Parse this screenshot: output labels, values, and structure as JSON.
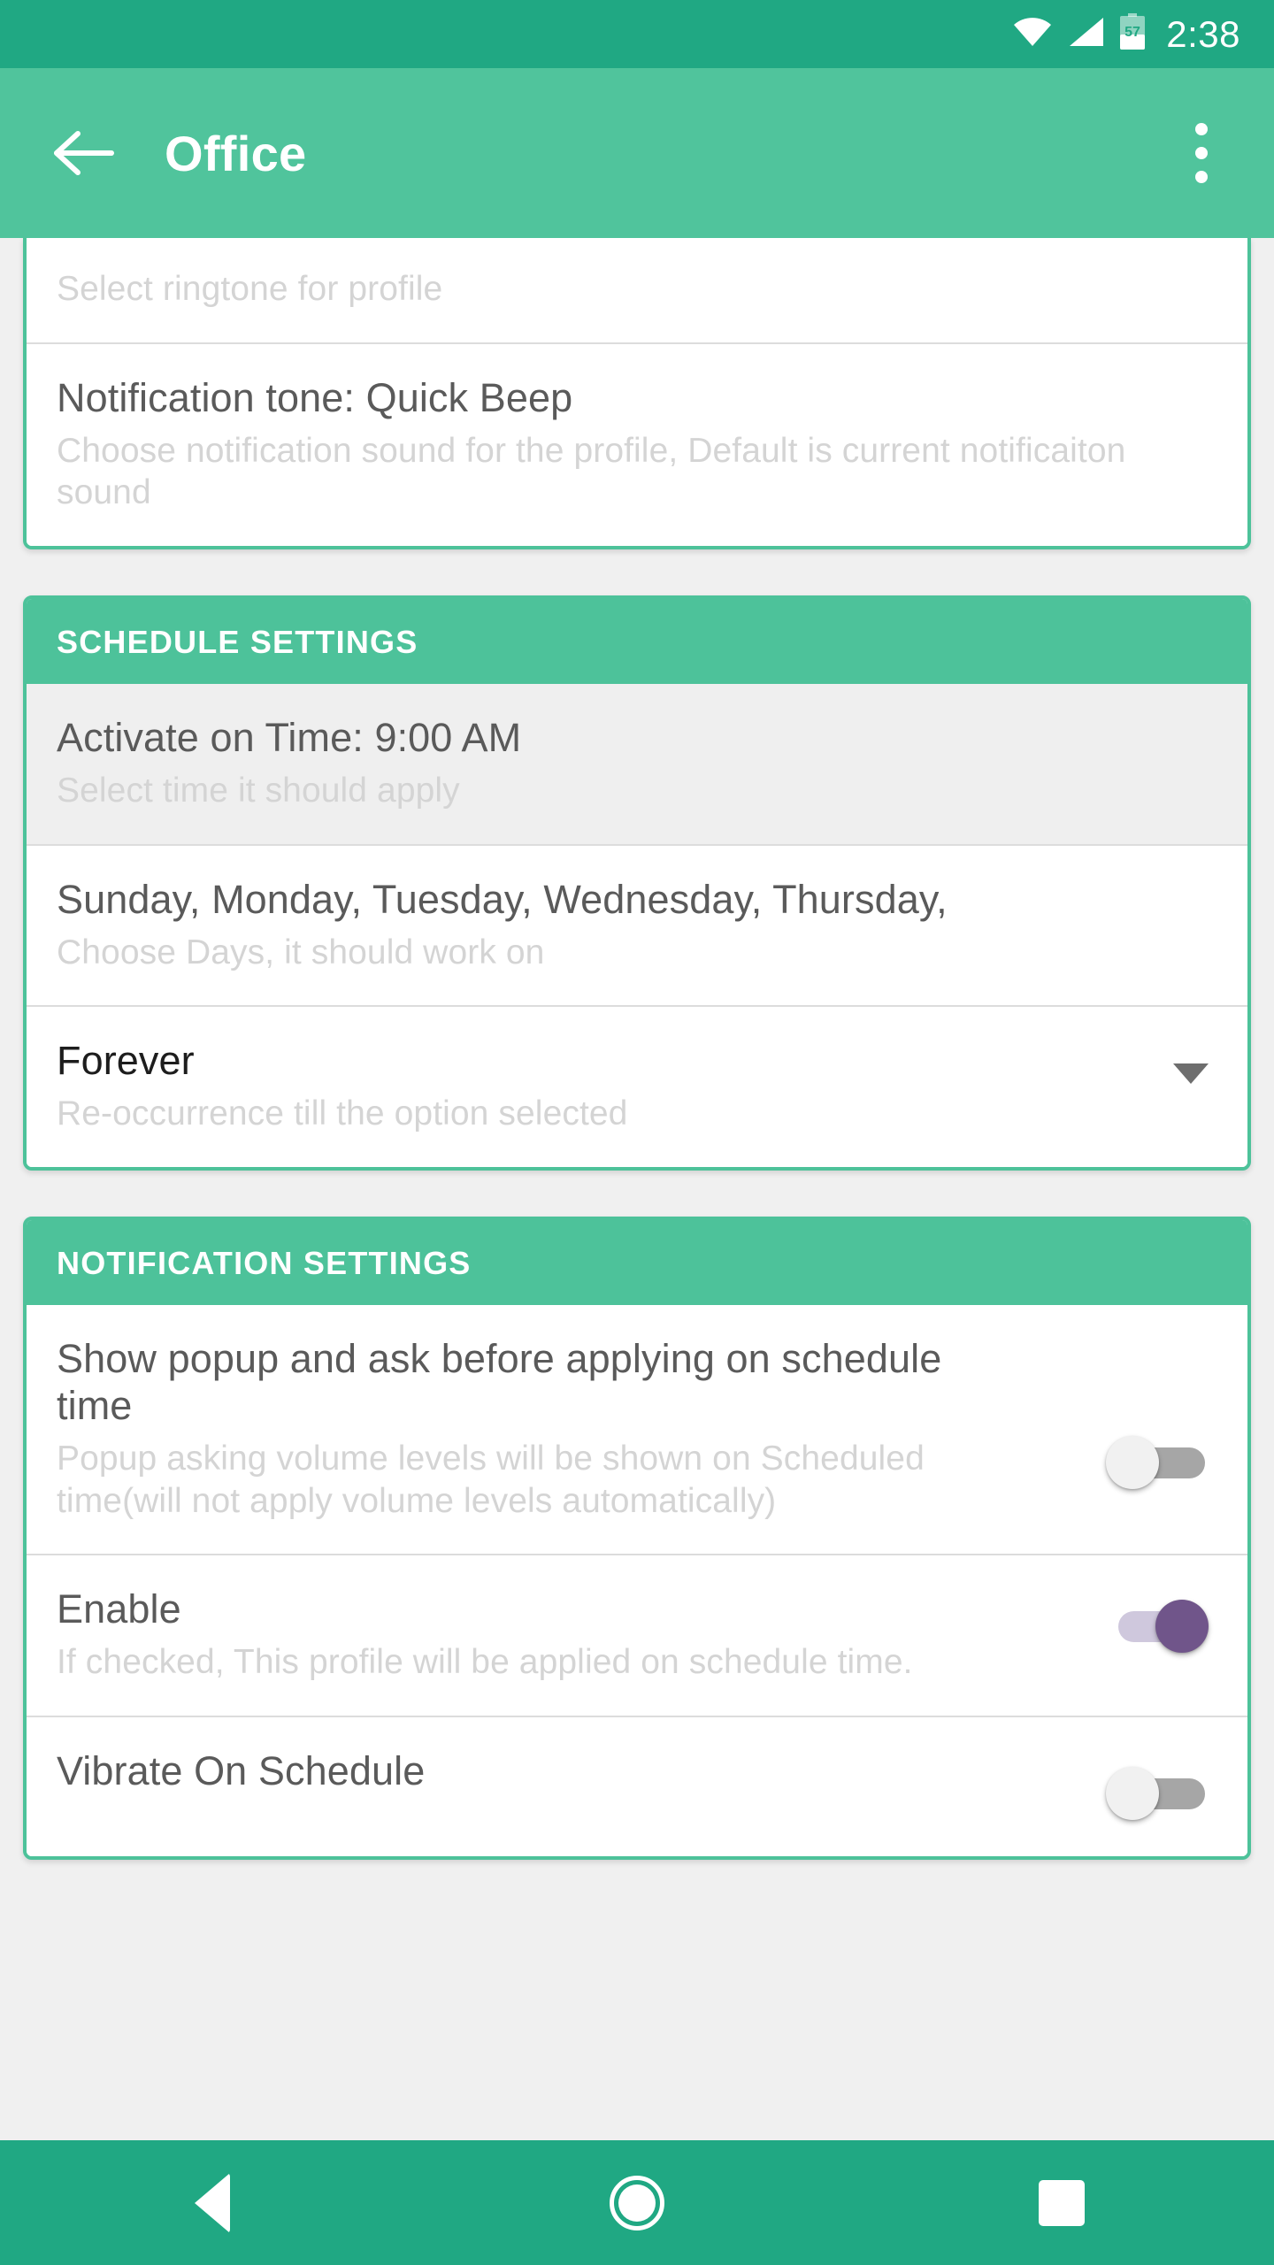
{
  "statusbar": {
    "time": "2:38",
    "battery_level": "57",
    "icons": [
      "wifi-icon",
      "cellular-signal-icon",
      "battery-icon"
    ]
  },
  "appbar": {
    "title": "Office",
    "back_icon": "back-arrow-icon",
    "overflow_icon": "overflow-menu-icon"
  },
  "sound_card": {
    "rows": [
      {
        "title": "",
        "subtitle": "Select ringtone for profile"
      },
      {
        "title": "Notification tone: Quick Beep",
        "subtitle": "Choose notification sound for the profile, Default is current notificaiton sound"
      }
    ]
  },
  "schedule_card": {
    "header": "SCHEDULE SETTINGS",
    "rows": [
      {
        "title": "Activate on Time: 9:00 AM",
        "subtitle": "Select time it should apply"
      },
      {
        "title": "Sunday, Monday, Tuesday, Wednesday, Thursday,",
        "subtitle": "Choose Days, it should work on"
      },
      {
        "title": "Forever",
        "subtitle": "Re-occurrence till the option selected"
      }
    ]
  },
  "notification_card": {
    "header": "NOTIFICATION SETTINGS",
    "rows": [
      {
        "title": "Show popup and ask before applying on schedule time",
        "subtitle": "Popup asking volume levels will be shown on Scheduled time(will not apply volume levels automatically)",
        "switch_state": "off"
      },
      {
        "title": "Enable",
        "subtitle": "If checked, This profile will be applied on schedule time.",
        "switch_state": "on"
      },
      {
        "title": "Vibrate On Schedule",
        "subtitle": "",
        "switch_state": "off"
      }
    ]
  },
  "navbar": {
    "back_icon": "nav-back-icon",
    "home_icon": "nav-home-icon",
    "recents_icon": "nav-recents-icon"
  },
  "colors": {
    "status_bar_green": "#20a883",
    "app_bar_green": "#50c49c",
    "card_border_green": "#4dc29a",
    "switch_on_purple": "#70558a",
    "page_background": "#f0f0f0"
  }
}
